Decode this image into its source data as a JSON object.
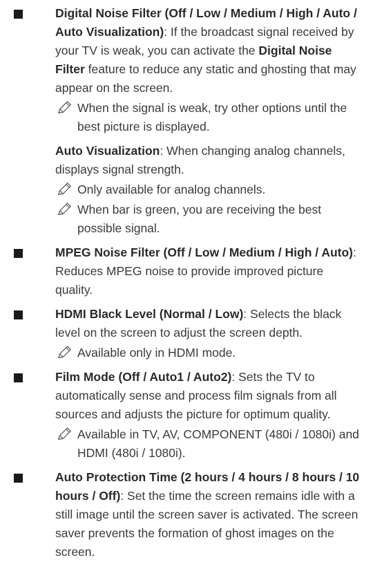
{
  "items": [
    {
      "title": "Digital Noise Filter (Off / Low / Medium / High / Auto / Auto Visualization)",
      "text": ": If the broadcast signal received by your TV is weak, you can activate the ",
      "bold2": "Digital Noise Filter",
      "text2": " feature to reduce any static and ghosting that may appear on the screen.",
      "note1": "When the signal is weak, try other options until the best picture is displayed.",
      "sub_title": "Auto Visualization",
      "sub_text": ": When changing analog channels, displays signal strength.",
      "note2": "Only available for analog channels.",
      "note3": "When bar is green, you are receiving the best possible signal."
    },
    {
      "title": "MPEG Noise Filter (Off / Low / Medium / High / Auto)",
      "text": ": Reduces MPEG noise to provide improved picture quality."
    },
    {
      "title": "HDMI Black Level (Normal / Low)",
      "text": ": Selects the black level on the screen to adjust the screen depth.",
      "note1": "Available only in HDMI mode."
    },
    {
      "title": "Film Mode (Off / Auto1 / Auto2)",
      "text": ": Sets the TV to automatically sense and process film signals from all sources and adjusts the picture for optimum quality.",
      "note1": "Available in TV, AV, COMPONENT (480i / 1080i) and HDMI (480i / 1080i)."
    },
    {
      "title": "Auto Protection Time (2 hours / 4 hours / 8 hours / 10 hours / Off)",
      "text": ": Set the time the screen remains idle with a still image until the screen saver is activated. The screen saver prevents the formation of ghost images on the screen."
    }
  ],
  "icons": {
    "bullet": "square-bullet-icon",
    "note": "pencil-note-icon"
  },
  "colors": {
    "text": "#3a3a3a",
    "bullet": "#1a1a1a"
  }
}
